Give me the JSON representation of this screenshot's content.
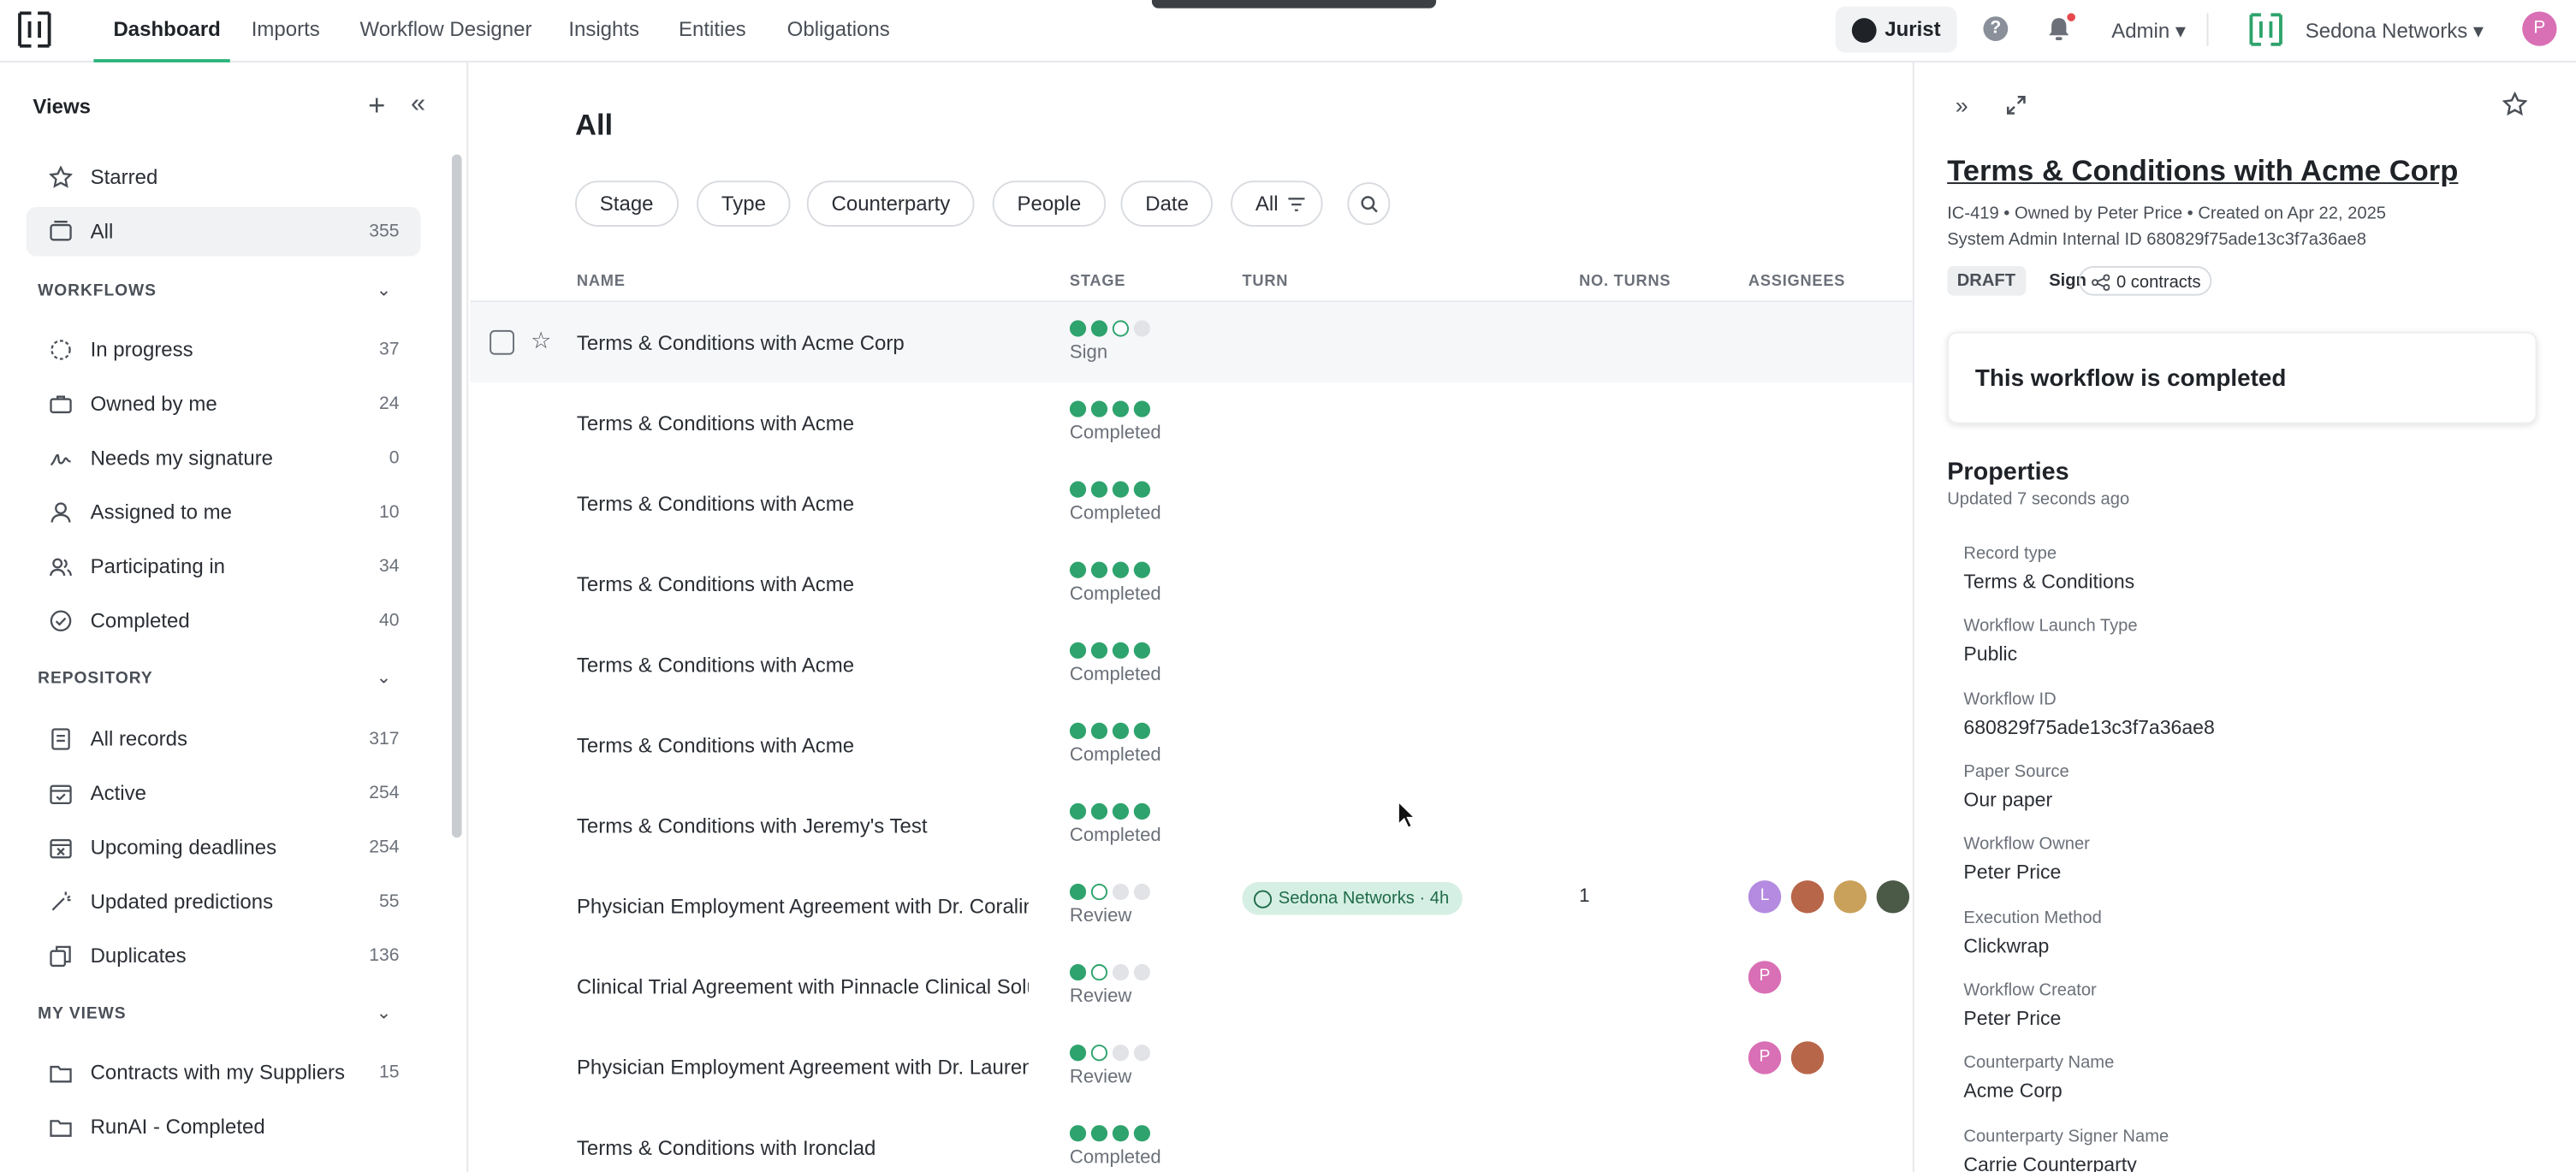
{
  "nav": {
    "tabs": [
      "Dashboard",
      "Imports",
      "Workflow Designer",
      "Insights",
      "Entities",
      "Obligations"
    ],
    "jurist": "Jurist",
    "admin": "Admin",
    "org": "Sedona Networks",
    "user_initial": "P"
  },
  "sidebar": {
    "title": "Views",
    "top_items": [
      {
        "label": "Starred",
        "count": ""
      },
      {
        "label": "All",
        "count": "355"
      }
    ],
    "workflows_title": "WORKFLOWS",
    "workflows": [
      {
        "label": "In progress",
        "count": "37"
      },
      {
        "label": "Owned by me",
        "count": "24"
      },
      {
        "label": "Needs my signature",
        "count": "0"
      },
      {
        "label": "Assigned to me",
        "count": "10"
      },
      {
        "label": "Participating in",
        "count": "34"
      },
      {
        "label": "Completed",
        "count": "40"
      }
    ],
    "repository_title": "REPOSITORY",
    "repository": [
      {
        "label": "All records",
        "count": "317"
      },
      {
        "label": "Active",
        "count": "254"
      },
      {
        "label": "Upcoming deadlines",
        "count": "254"
      },
      {
        "label": "Updated predictions",
        "count": "55"
      },
      {
        "label": "Duplicates",
        "count": "136"
      }
    ],
    "myviews_title": "MY VIEWS",
    "myviews": [
      {
        "label": "Contracts with my Suppliers",
        "count": "15"
      },
      {
        "label": "RunAI - Completed",
        "count": ""
      }
    ]
  },
  "main": {
    "title": "All",
    "filters": [
      "Stage",
      "Type",
      "Counterparty",
      "People",
      "Date",
      "All"
    ],
    "columns": [
      "NAME",
      "STAGE",
      "TURN",
      "NO. TURNS",
      "ASSIGNEES"
    ],
    "rows": [
      {
        "name": "Terms & Conditions with Acme Corp",
        "stage": "Sign",
        "progress": "2/4"
      },
      {
        "name": "Terms & Conditions with Acme",
        "stage": "Completed",
        "progress": "4/4"
      },
      {
        "name": "Terms & Conditions with Acme",
        "stage": "Completed",
        "progress": "4/4"
      },
      {
        "name": "Terms & Conditions with Acme",
        "stage": "Completed",
        "progress": "4/4"
      },
      {
        "name": "Terms & Conditions with Acme",
        "stage": "Completed",
        "progress": "4/4"
      },
      {
        "name": "Terms & Conditions with Acme",
        "stage": "Completed",
        "progress": "4/4"
      },
      {
        "name": "Terms & Conditions with Jeremy's Test",
        "stage": "Completed",
        "progress": "4/4"
      },
      {
        "name": "Physician Employment Agreement with Dr. Coraline",
        "stage": "Review",
        "progress": "1/4",
        "turn": "Sedona Networks · 4h",
        "turns": "1",
        "assignees": [
          "L",
          "",
          "",
          ""
        ]
      },
      {
        "name": "Clinical Trial Agreement with Pinnacle Clinical Solut",
        "stage": "Review",
        "progress": "1/4",
        "assignees": [
          "P"
        ]
      },
      {
        "name": "Physician Employment Agreement with Dr. Lauren I",
        "stage": "Review",
        "progress": "1/4",
        "assignees": [
          "P",
          ""
        ]
      },
      {
        "name": "Terms & Conditions with Ironclad",
        "stage": "Completed",
        "progress": "4/4"
      }
    ]
  },
  "panel": {
    "title": "Terms & Conditions with Acme Corp",
    "meta1": "IC-419  •  Owned by Peter Price  •  Created on Apr 22, 2025",
    "meta2": "System Admin Internal ID 680829f75ade13c3f7a36ae8",
    "tags": {
      "status": "DRAFT",
      "stage": "Sign",
      "contracts": "0 contracts"
    },
    "notice": "This workflow is completed",
    "properties_title": "Properties",
    "properties_updated": "Updated 7 seconds ago",
    "properties": [
      {
        "label": "Record type",
        "value": "Terms & Conditions"
      },
      {
        "label": "Workflow Launch Type",
        "value": "Public"
      },
      {
        "label": "Workflow ID",
        "value": "680829f75ade13c3f7a36ae8"
      },
      {
        "label": "Paper Source",
        "value": "Our paper"
      },
      {
        "label": "Workflow Owner",
        "value": "Peter Price"
      },
      {
        "label": "Execution Method",
        "value": "Clickwrap"
      },
      {
        "label": "Workflow Creator",
        "value": "Peter Price"
      },
      {
        "label": "Counterparty Name",
        "value": "Acme Corp"
      },
      {
        "label": "Counterparty Signer Name",
        "value": "Carrie Counterparty"
      }
    ]
  },
  "colors": {
    "accent": "#2ea36d",
    "badge_bg": "#d6efe4",
    "avatar_pink": "#d96fb5",
    "avatar_purple": "#b48be0"
  }
}
